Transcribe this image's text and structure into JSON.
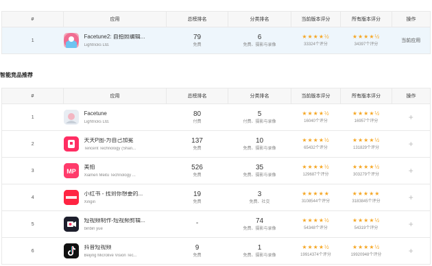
{
  "headers": [
    "#",
    "应用",
    "总榜排名",
    "分类排名",
    "当前版本评分",
    "所有版本评分",
    "操作"
  ],
  "current": {
    "index": "1",
    "name": "Facetune2: 自拍照编辑...",
    "developer": "Lightricks Ltd.",
    "total_rank": "79",
    "total_type": "免费",
    "cat_rank": "6",
    "cat_type": "免费、摄影与录像",
    "cur_stars": "★★★★½",
    "cur_count": "33324个评分",
    "all_stars": "★★★★½",
    "all_count": "34397个评分",
    "op": "当前应用",
    "icon": "facetune2-icon"
  },
  "section_title": "智能竞品推荐",
  "rows": [
    {
      "index": "1",
      "name": "Facetune",
      "developer": "Lightricks Ltd.",
      "total_rank": "80",
      "total_type": "付费",
      "cat_rank": "5",
      "cat_type": "付费、摄影与录像",
      "cur_stars": "★★★★½",
      "cur_count": "16040个评分",
      "all_stars": "★★★★½",
      "all_count": "16957个评分",
      "op": "+",
      "icon": "facetune-icon",
      "icon_bg": "#e8edf3"
    },
    {
      "index": "2",
      "name": "天天P图-为自己加冕",
      "developer": "Tencent Technology (Shan...",
      "total_rank": "137",
      "total_type": "免费",
      "cat_rank": "10",
      "cat_type": "免费、摄影与录像",
      "cur_stars": "★★★★½",
      "cur_count": "65432个评分",
      "all_stars": "★★★★½",
      "all_count": "131829个评分",
      "op": "+",
      "icon": "pitu-icon",
      "icon_bg": "#ff2e63"
    },
    {
      "index": "3",
      "name": "美拍",
      "developer": "Xiamen Meitu Technology ...",
      "total_rank": "526",
      "total_type": "免费",
      "cat_rank": "35",
      "cat_type": "免费、摄影与录像",
      "cur_stars": "★★★★½",
      "cur_count": "129687个评分",
      "all_stars": "★★★★½",
      "all_count": "303279个评分",
      "op": "+",
      "icon": "meipai-icon",
      "icon_bg": "#ff3b6b"
    },
    {
      "index": "4",
      "name": "小红书 - 找到你想要的...",
      "developer": "Xingin",
      "total_rank": "19",
      "total_type": "免费",
      "cat_rank": "3",
      "cat_type": "免费、社交",
      "cur_stars": "★★★★★",
      "cur_count": "3108544个评分",
      "all_stars": "★★★★★",
      "all_count": "3183845个评分",
      "op": "+",
      "icon": "xiaohongshu-icon",
      "icon_bg": "#ff2442"
    },
    {
      "index": "5",
      "name": "短视频制作-短视频剪辑...",
      "developer": "binbin yue",
      "total_rank": "-",
      "total_type": "",
      "cat_rank": "74",
      "cat_type": "免费、摄影与录像",
      "cur_stars": "★★★★½",
      "cur_count": "54348个评分",
      "all_stars": "★★★★½",
      "all_count": "54319个评分",
      "op": "+",
      "icon": "video-editor-icon",
      "icon_bg": "#1d1e2c"
    },
    {
      "index": "6",
      "name": "抖音短视频",
      "developer": "Beijing Microlive Vision Tec...",
      "total_rank": "9",
      "total_type": "免费",
      "cat_rank": "1",
      "cat_type": "免费、摄影与录像",
      "cur_stars": "★★★★½",
      "cur_count": "19914374个评分",
      "all_stars": "★★★★½",
      "all_count": "19920948个评分",
      "op": "+",
      "icon": "douyin-icon",
      "icon_bg": "#111111"
    }
  ],
  "colors": {
    "star": "#f5a623",
    "current_row_bg": "#eef6fc",
    "header_bg": "#f7f7f7"
  }
}
